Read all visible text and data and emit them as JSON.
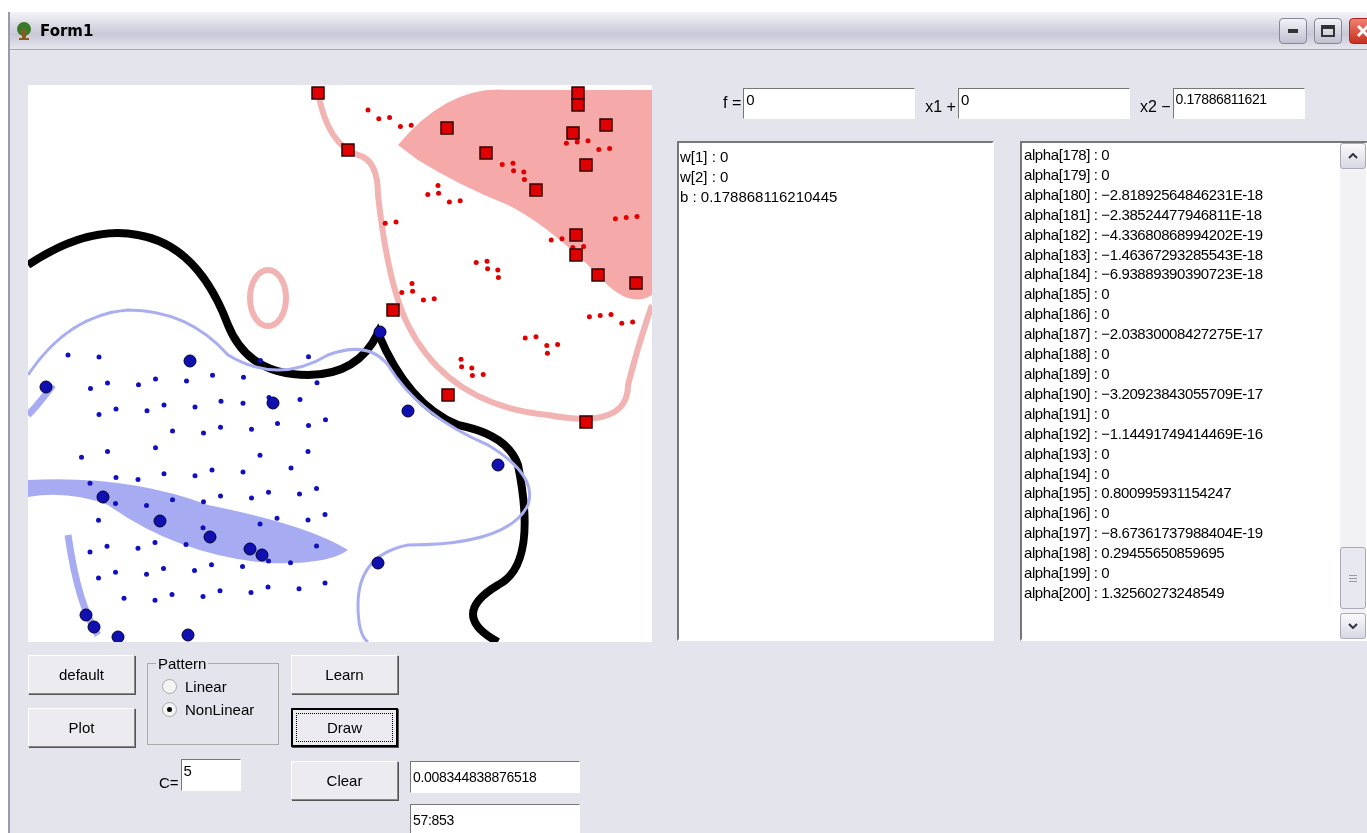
{
  "window": {
    "title": "Form1"
  },
  "equation": {
    "f_label": "f =",
    "f_value": "0",
    "x1_label": "x1 +",
    "x1_value": "0",
    "x2_label": "x2 −",
    "x2_value": "0.17886811621"
  },
  "weights": [
    "w[1] : 0",
    "w[2] : 0",
    "b : 0.178868116210445"
  ],
  "alphas": [
    "alpha[178] : 0",
    "alpha[179] : 0",
    "alpha[180] : −2.81892564846231E-18",
    "alpha[181] : −2.38524477946811E-18",
    "alpha[182] : −4.33680868994202E-19",
    "alpha[183] : −1.46367293285543E-18",
    "alpha[184] : −6.93889390390723E-18",
    "alpha[185] : 0",
    "alpha[186] : 0",
    "alpha[187] : −2.03830008427275E-17",
    "alpha[188] : 0",
    "alpha[189] : 0",
    "alpha[190] : −3.20923843055709E-17",
    "alpha[191] : 0",
    "alpha[192] : −1.14491749414469E-16",
    "alpha[193] : 0",
    "alpha[194] : 0",
    "alpha[195] : 0.800995931154247",
    "alpha[196] : 0",
    "alpha[197] : −8.67361737988404E-19",
    "alpha[198] : 0.29455650859695",
    "alpha[199] : 0",
    "alpha[200] : 1.32560273248549"
  ],
  "buttons": {
    "default": {
      "label": "default",
      "focused": false
    },
    "plot": {
      "label": "Plot",
      "focused": false
    },
    "learn": {
      "label": "Learn",
      "focused": false
    },
    "draw": {
      "label": "Draw",
      "focused": true
    },
    "clear": {
      "label": "Clear",
      "focused": false
    }
  },
  "pattern": {
    "title": "Pattern",
    "options": [
      {
        "label": "Linear",
        "selected": false
      },
      {
        "label": "NonLinear",
        "selected": true
      }
    ]
  },
  "c_param": {
    "label": "C=",
    "value": "5"
  },
  "outputs": [
    "0.008344838876518",
    "57:853"
  ]
}
